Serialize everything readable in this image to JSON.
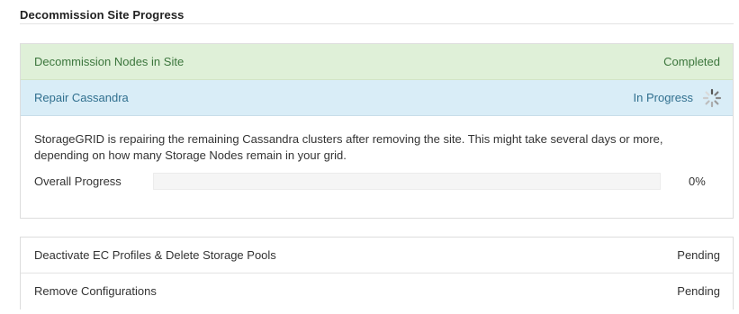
{
  "section": {
    "title": "Decommission Site Progress"
  },
  "steps": [
    {
      "label": "Decommission Nodes in Site",
      "status": "Completed"
    },
    {
      "label": "Repair Cassandra",
      "status": "In Progress"
    },
    {
      "label": "Deactivate EC Profiles & Delete Storage Pools",
      "status": "Pending"
    },
    {
      "label": "Remove Configurations",
      "status": "Pending"
    }
  ],
  "details": {
    "description": "StorageGRID is repairing the remaining Cassandra clusters after removing the site. This might take several days or more, depending on how many Storage Nodes remain in your grid.",
    "progress_label": "Overall Progress",
    "progress_value": "0%",
    "progress_fraction": 0
  },
  "colors": {
    "completed_bg": "#dff0d8",
    "completed_text": "#3c763d",
    "in_progress_bg": "#d9edf7",
    "in_progress_text": "#31708f",
    "progress_fill": "#5bc0de"
  },
  "icons": {
    "in_progress": "spinner-icon"
  }
}
